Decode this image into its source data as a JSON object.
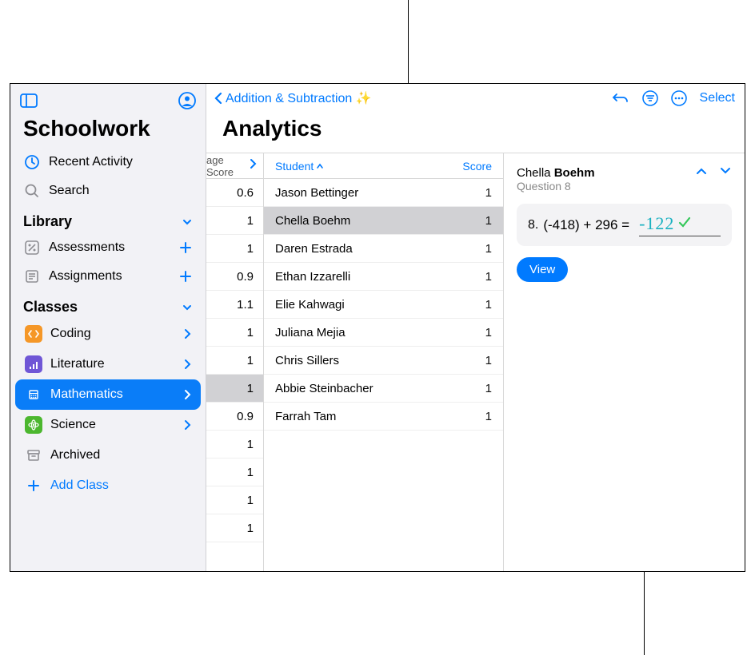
{
  "app": {
    "title": "Schoolwork"
  },
  "sidebar": {
    "recent": "Recent Activity",
    "search": "Search",
    "librarySection": "Library",
    "assessments": "Assessments",
    "assignments": "Assignments",
    "classesSection": "Classes",
    "classes": [
      {
        "label": "Coding",
        "selected": false,
        "bg": "#f59727"
      },
      {
        "label": "Literature",
        "selected": false,
        "bg": "#6f56d6"
      },
      {
        "label": "Mathematics",
        "selected": true,
        "bg": "#0a7df8"
      },
      {
        "label": "Science",
        "selected": false,
        "bg": "#4cb72f"
      }
    ],
    "archived": "Archived",
    "addClass": "Add Class"
  },
  "main": {
    "backLabel": "Addition & Subtraction ✨",
    "title": "Analytics",
    "selectLabel": "Select",
    "scoreColHeader": "age Score",
    "scoreRows": [
      "0.6",
      "1",
      "1",
      "0.9",
      "1.1",
      "1",
      "1",
      "1",
      "0.9",
      "1",
      "1",
      "1",
      "1"
    ],
    "scoreSelectedIndex": 7,
    "studentSort": "Student",
    "studentScoreHeader": "Score",
    "students": [
      {
        "name": "Jason Bettinger",
        "score": "1"
      },
      {
        "name": "Chella Boehm",
        "score": "1",
        "selected": true
      },
      {
        "name": "Daren Estrada",
        "score": "1"
      },
      {
        "name": "Ethan Izzarelli",
        "score": "1"
      },
      {
        "name": "Elie Kahwagi",
        "score": "1"
      },
      {
        "name": "Juliana Mejia",
        "score": "1"
      },
      {
        "name": "Chris Sillers",
        "score": "1"
      },
      {
        "name": "Abbie Steinbacher",
        "score": "1"
      },
      {
        "name": "Farrah Tam",
        "score": "1"
      }
    ]
  },
  "detail": {
    "studentFirst": "Chella",
    "studentLast": "Boehm",
    "questionLabel": "Question 8",
    "qNumber": "8.",
    "qText": "(-418) + 296 =",
    "answer": "-122",
    "viewLabel": "View"
  }
}
